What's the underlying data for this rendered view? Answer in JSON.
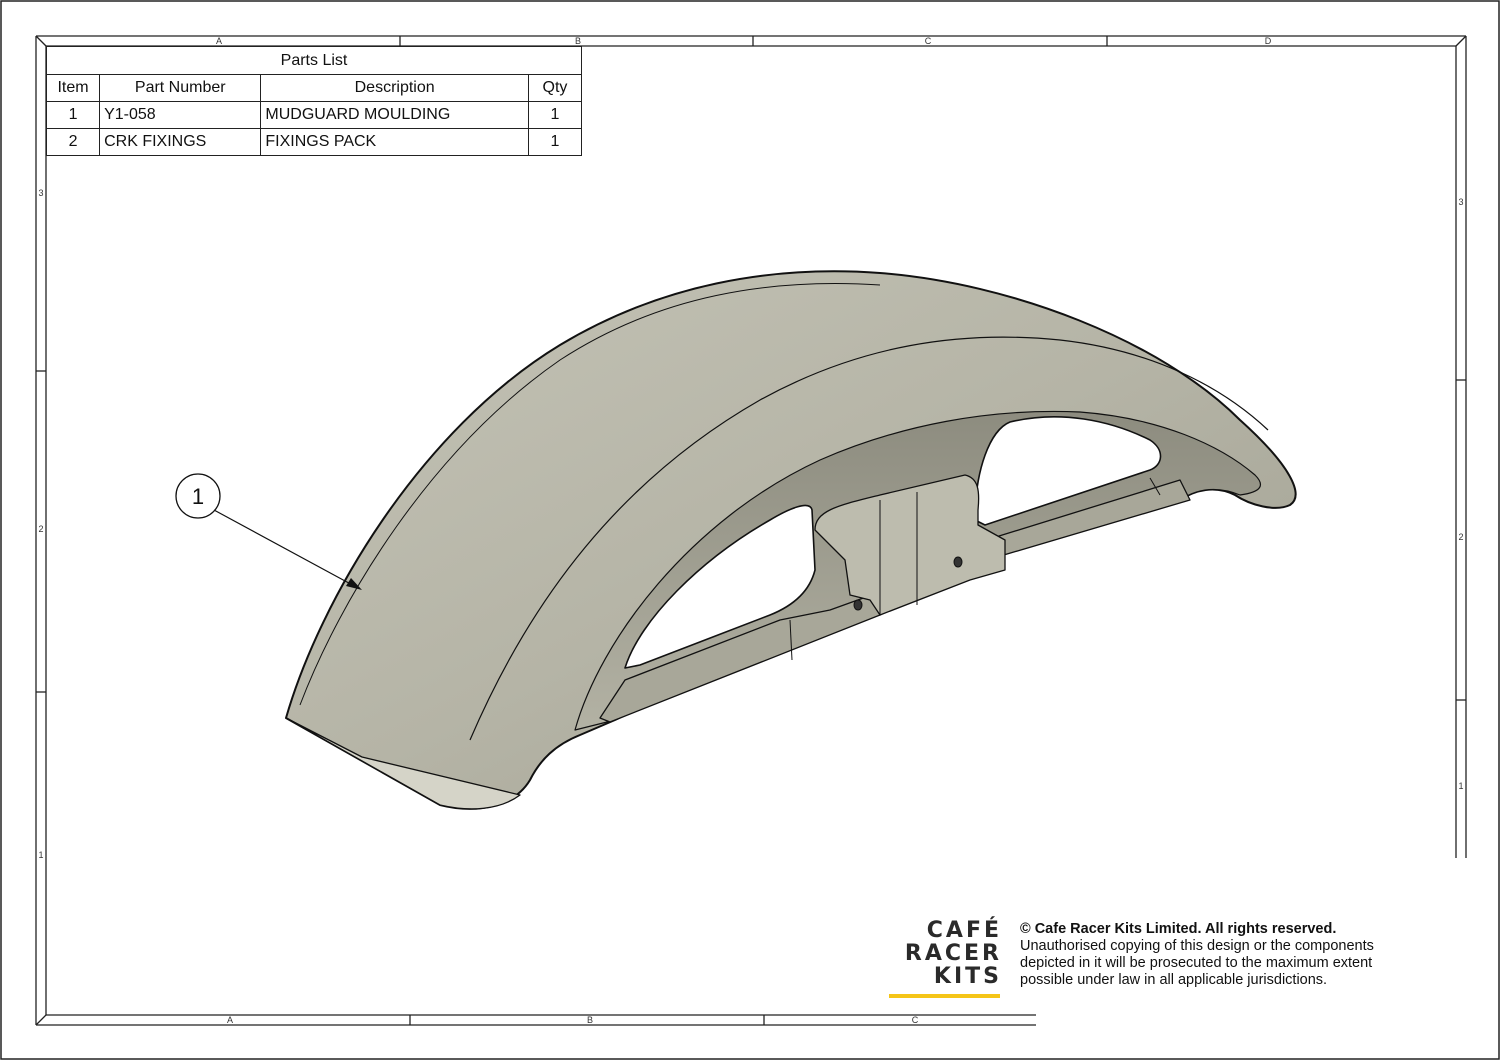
{
  "parts_list": {
    "title": "Parts List",
    "headers": {
      "item": "Item",
      "part_number": "Part Number",
      "description": "Description",
      "qty": "Qty"
    },
    "rows": [
      {
        "item": "1",
        "part_number": "Y1-058",
        "description": "MUDGUARD MOULDING",
        "qty": "1"
      },
      {
        "item": "2",
        "part_number": "CRK FIXINGS",
        "description": "FIXINGS PACK",
        "qty": "1"
      }
    ]
  },
  "frame": {
    "top_columns": [
      "A",
      "B",
      "C",
      "D"
    ],
    "bottom_columns": [
      "A",
      "B",
      "C"
    ],
    "left_rows": [
      "3",
      "2",
      "1"
    ],
    "right_rows": [
      "3",
      "2",
      "1"
    ]
  },
  "balloon": {
    "label": "1"
  },
  "logo": {
    "line1": "CAFÉ",
    "line2": "RACER",
    "line3": "KITS",
    "accent_color": "#f5c518"
  },
  "copyright": {
    "line1": "© Cafe Racer Kits Limited. All rights reserved.",
    "line2": "Unauthorised copying of this design or the components",
    "line3": "depicted in it will be prosecuted to the maximum extent",
    "line4": "possible under law in all applicable jurisdictions."
  },
  "colors": {
    "part_fill": "#b9b8aa",
    "part_shadow": "#8f8e80",
    "line": "#111111"
  }
}
